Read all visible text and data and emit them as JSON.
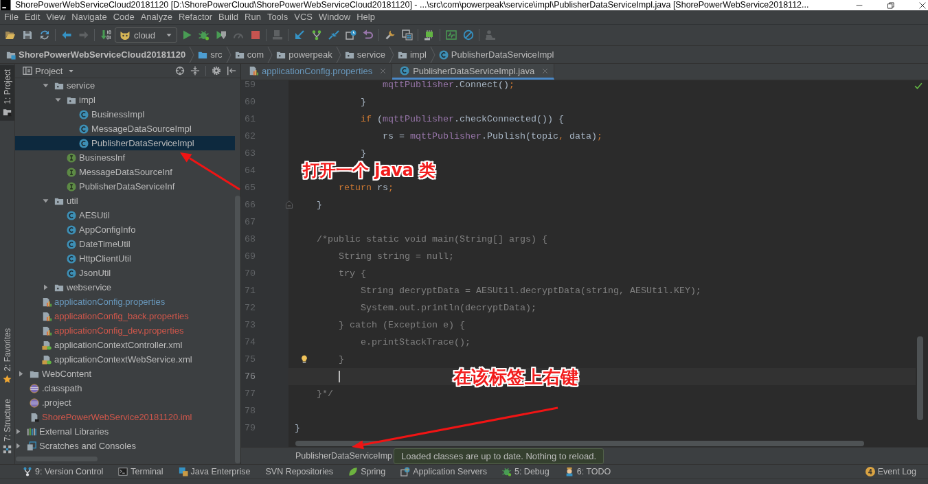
{
  "window": {
    "title": "ShorePowerWebServiceCloud20181120 [D:\\ShorePowerCloud\\ShorePowerWebServiceCloud20181120] - ...\\src\\com\\powerpeak\\service\\impl\\PublisherDataServiceImpl.java [ShorePowerWebService2018112..."
  },
  "menu": [
    "File",
    "Edit",
    "View",
    "Navigate",
    "Code",
    "Analyze",
    "Refactor",
    "Build",
    "Run",
    "Tools",
    "VCS",
    "Window",
    "Help"
  ],
  "toolbar": {
    "run_configuration": "cloud"
  },
  "nav_bar": [
    {
      "label": "ShorePowerWebServiceCloud20181120",
      "kind": "project"
    },
    {
      "label": "src",
      "kind": "source"
    },
    {
      "label": "com",
      "kind": "package"
    },
    {
      "label": "powerpeak",
      "kind": "package"
    },
    {
      "label": "service",
      "kind": "package"
    },
    {
      "label": "impl",
      "kind": "package"
    },
    {
      "label": "PublisherDataServiceImpl",
      "kind": "class"
    }
  ],
  "tool_strip": {
    "top": [
      {
        "label": "1: Project",
        "kind": "project",
        "selected": true
      }
    ],
    "bottom": [
      {
        "label": "2: Favorites",
        "kind": "favorites",
        "selected": false
      },
      {
        "label": "7: Structure",
        "kind": "structure",
        "selected": false
      }
    ]
  },
  "project_panel": {
    "title": "Project",
    "tree": [
      {
        "children": [
          {
            "children": [
              {
                "children": [
                  {
                    "label": "service",
                    "kind": "package",
                    "expanded": true,
                    "selected": false,
                    "children": [
                      {
                        "label": "impl",
                        "kind": "package",
                        "expanded": true,
                        "selected": false,
                        "children": [
                          {
                            "label": "BusinessImpl",
                            "kind": "class",
                            "selected": false
                          },
                          {
                            "label": "MessageDataSourceImpl",
                            "kind": "class",
                            "selected": false
                          },
                          {
                            "label": "PublisherDataServiceImpl",
                            "kind": "class",
                            "selected": true
                          }
                        ]
                      },
                      {
                        "label": "BusinessInf",
                        "kind": "interface",
                        "selected": false
                      },
                      {
                        "label": "MessageDataSourceInf",
                        "kind": "interface",
                        "selected": false
                      },
                      {
                        "label": "PublisherDataServiceInf",
                        "kind": "interface",
                        "selected": false
                      }
                    ]
                  },
                  {
                    "label": "util",
                    "kind": "package",
                    "expanded": true,
                    "selected": false,
                    "children": [
                      {
                        "label": "AESUtil",
                        "kind": "class",
                        "selected": false
                      },
                      {
                        "label": "AppConfigInfo",
                        "kind": "class",
                        "selected": false
                      },
                      {
                        "label": "DateTimeUtil",
                        "kind": "class",
                        "selected": false
                      },
                      {
                        "label": "HttpClientUtil",
                        "kind": "class",
                        "selected": false
                      },
                      {
                        "label": "JsonUtil",
                        "kind": "class",
                        "selected": false
                      }
                    ]
                  },
                  {
                    "label": "webservice",
                    "kind": "package",
                    "expanded": false,
                    "selected": false
                  }
                ]
              },
              {
                "label": "applicationConfig.properties",
                "kind": "properties",
                "color": "#6897bb",
                "selected": false
              },
              {
                "label": "applicationConfig_back.properties",
                "kind": "properties",
                "color": "#d1574b",
                "selected": false
              },
              {
                "label": "applicationConfig_dev.properties",
                "kind": "properties",
                "color": "#d1574b",
                "selected": false
              },
              {
                "label": "applicationContextController.xml",
                "kind": "xml",
                "selected": false
              },
              {
                "label": "applicationContextWebService.xml",
                "kind": "xml",
                "selected": false
              }
            ]
          },
          {
            "label": "WebContent",
            "kind": "folder",
            "expanded": false,
            "selected": false
          },
          {
            "label": ".classpath",
            "kind": "eclipse",
            "selected": false
          },
          {
            "label": ".project",
            "kind": "eclipse",
            "selected": false
          },
          {
            "label": "ShorePowerWebService20181120.iml",
            "kind": "iml",
            "color": "#d1574b",
            "selected": false
          }
        ]
      },
      {
        "label": "External Libraries",
        "kind": "libraries",
        "expanded": false,
        "selected": false
      },
      {
        "label": "Scratches and Consoles",
        "kind": "scratches",
        "expanded": false,
        "selected": false
      }
    ]
  },
  "editor": {
    "tabs": [
      {
        "label": "applicationConfig.properties",
        "kind": "properties",
        "color": "#6897bb",
        "selected": false
      },
      {
        "label": "PublisherDataServiceImpl.java",
        "kind": "class",
        "selected": true
      }
    ],
    "lines": [
      {
        "number": "59",
        "current": false,
        "segments": [
          {
            "kind": "field",
            "text": "                mqttPublisher"
          },
          {
            "kind": "plain",
            "text": ".Connect()"
          },
          {
            "kind": "keyword",
            "text": ";"
          }
        ]
      },
      {
        "number": "60",
        "current": false,
        "segments": [
          {
            "kind": "plain",
            "text": "            }"
          }
        ]
      },
      {
        "number": "61",
        "current": false,
        "segments": [
          {
            "kind": "keyword",
            "text": "            if"
          },
          {
            "kind": "plain",
            "text": " ("
          },
          {
            "kind": "field",
            "text": "mqttPublisher"
          },
          {
            "kind": "plain",
            "text": ".checkConnected()) {"
          }
        ]
      },
      {
        "number": "62",
        "current": false,
        "segments": [
          {
            "kind": "plain",
            "text": "                rs = "
          },
          {
            "kind": "field",
            "text": "mqttPublisher"
          },
          {
            "kind": "plain",
            "text": ".Publish(topic"
          },
          {
            "kind": "keyword",
            "text": ","
          },
          {
            "kind": "plain",
            "text": " data)"
          },
          {
            "kind": "keyword",
            "text": ";"
          }
        ]
      },
      {
        "number": "63",
        "current": false,
        "segments": [
          {
            "kind": "plain",
            "text": "            }"
          }
        ]
      },
      {
        "number": "64",
        "current": false
      },
      {
        "number": "65",
        "current": false,
        "segments": [
          {
            "kind": "keyword",
            "text": "        return"
          },
          {
            "kind": "plain",
            "text": " rs"
          },
          {
            "kind": "keyword",
            "text": ";"
          }
        ]
      },
      {
        "number": "66",
        "current": false,
        "fold_marker": true,
        "segments": [
          {
            "kind": "plain",
            "text": "    }"
          }
        ]
      },
      {
        "number": "67",
        "current": false
      },
      {
        "number": "68",
        "current": false,
        "segments": [
          {
            "kind": "comment",
            "text": "    /*public static void main(String[] args) {"
          }
        ]
      },
      {
        "number": "69",
        "current": false,
        "segments": [
          {
            "kind": "comment",
            "text": "        String string = null;"
          }
        ]
      },
      {
        "number": "70",
        "current": false,
        "segments": [
          {
            "kind": "comment",
            "text": "        try {"
          }
        ]
      },
      {
        "number": "71",
        "current": false,
        "segments": [
          {
            "kind": "comment",
            "text": "            String decryptData = AESUtil.decryptData(string, AESUtil.KEY);"
          }
        ]
      },
      {
        "number": "72",
        "current": false,
        "segments": [
          {
            "kind": "comment",
            "text": "            System.out.println(decryptData);"
          }
        ]
      },
      {
        "number": "73",
        "current": false,
        "segments": [
          {
            "kind": "comment",
            "text": "        } catch (Exception e) {"
          }
        ]
      },
      {
        "number": "74",
        "current": false,
        "segments": [
          {
            "kind": "comment",
            "text": "            e.printStackTrace();"
          }
        ]
      },
      {
        "number": "75",
        "current": false,
        "bulb": true,
        "segments": [
          {
            "kind": "comment",
            "text": "        }"
          }
        ]
      },
      {
        "number": "76",
        "current": true
      },
      {
        "number": "77",
        "current": false,
        "segments": [
          {
            "kind": "comment",
            "text": "    }*/"
          }
        ]
      },
      {
        "number": "78",
        "current": false
      },
      {
        "number": "79",
        "current": false,
        "segments": [
          {
            "kind": "plain",
            "text": "}"
          }
        ]
      }
    ],
    "breadcrumb": "PublisherDataServiceImp"
  },
  "tooltip": "Loaded classes are up to date. Nothing to reload.",
  "tool_window_bar": {
    "left": [
      {
        "label": "9: Version Control",
        "kind": "vcs"
      },
      {
        "label": "Terminal",
        "kind": "terminal"
      },
      {
        "label": "Java Enterprise",
        "kind": "javaee"
      },
      {
        "label": "SVN Repositories",
        "kind": "plain"
      },
      {
        "label": "Spring",
        "kind": "spring"
      },
      {
        "label": "Application Servers",
        "kind": "servers"
      },
      {
        "label": "5: Debug",
        "kind": "debug"
      },
      {
        "label": "6: TODO",
        "kind": "todo"
      }
    ],
    "right": [
      {
        "label": "Event Log",
        "kind": "event_log",
        "count": "4"
      }
    ]
  },
  "annotations": [
    {
      "text": "打开一个 java 类"
    },
    {
      "text": "在该标签上右键"
    }
  ]
}
